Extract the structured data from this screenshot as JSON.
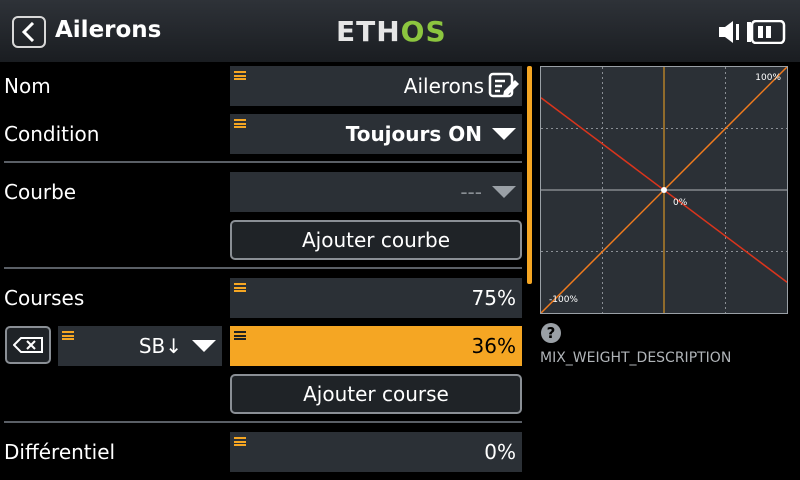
{
  "header": {
    "title": "Ailerons",
    "logo_left": "ETH",
    "logo_right": "OS"
  },
  "form": {
    "name_label": "Nom",
    "name_value": "Ailerons",
    "condition_label": "Condition",
    "condition_value": "Toujours ON",
    "curve_label": "Courbe",
    "curve_value": "---",
    "add_curve": "Ajouter courbe",
    "rates_label": "Courses",
    "rates_value": "75%",
    "switch_value": "SB↓",
    "switch_rate_value": "36%",
    "add_rate": "Ajouter course",
    "diff_label": "Différentiel",
    "diff_value": "0%"
  },
  "chart_data": {
    "type": "line",
    "series": [
      {
        "values": [
          [
            -100,
            -100
          ],
          [
            100,
            100
          ]
        ],
        "color": "#f07b1e"
      },
      {
        "values": [
          [
            -100,
            75
          ],
          [
            100,
            -75
          ]
        ],
        "color": "#d9341c"
      }
    ],
    "xlim": [
      -100,
      100
    ],
    "ylim": [
      -100,
      100
    ],
    "center_label": "0%",
    "top_label": "100%",
    "bottom_label": "-100%",
    "grid": true
  },
  "help": {
    "icon": "?",
    "description": "MIX_WEIGHT_DESCRIPTION"
  },
  "colors": {
    "accent": "#f5a623",
    "field": "#2b3036",
    "line_orange": "#f07b1e",
    "line_red": "#d9341c"
  }
}
